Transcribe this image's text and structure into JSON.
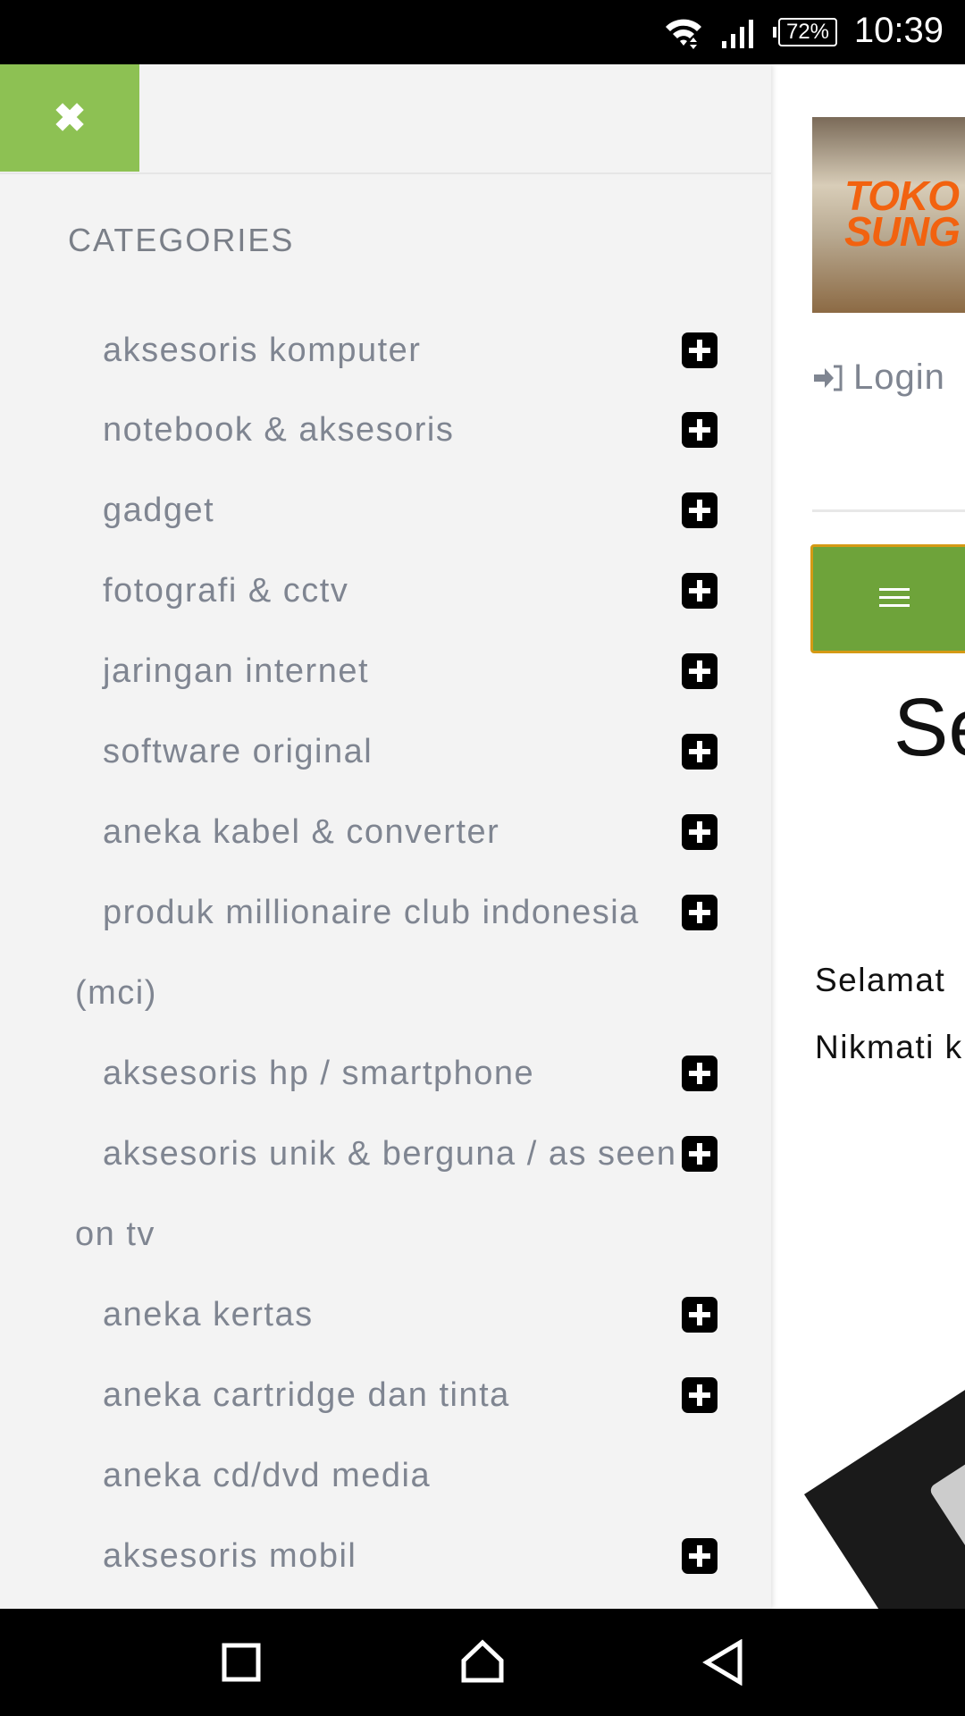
{
  "status_bar": {
    "time": "10:39",
    "battery": "72%",
    "icons": [
      "wifi-icon",
      "signal-icon",
      "battery-icon"
    ]
  },
  "page": {
    "logo_text": "TOKO SUNG",
    "login_label": "Login",
    "heading": "Se",
    "paragraphs": [
      "Selamat",
      "Nikmati k"
    ]
  },
  "drawer": {
    "close_icon": "close-icon",
    "title": "CATEGORIES",
    "items": [
      {
        "label": "aksesoris komputer",
        "expandable": true
      },
      {
        "label": "notebook & aksesoris",
        "expandable": true
      },
      {
        "label": "gadget",
        "expandable": true
      },
      {
        "label": "fotografi & cctv",
        "expandable": true
      },
      {
        "label": "jaringan internet",
        "expandable": true
      },
      {
        "label": "software original",
        "expandable": true
      },
      {
        "label": "aneka kabel & converter",
        "expandable": true
      },
      {
        "label": "produk millionaire club indonesia (mci)",
        "expandable": true
      },
      {
        "label": "aksesoris hp / smartphone",
        "expandable": true
      },
      {
        "label": "aksesoris unik & berguna / as seen on tv",
        "expandable": true
      },
      {
        "label": "aneka kertas",
        "expandable": true
      },
      {
        "label": "aneka cartridge dan tinta",
        "expandable": true
      },
      {
        "label": "aneka cd/dvd media",
        "expandable": false
      },
      {
        "label": "aksesoris mobil",
        "expandable": true
      }
    ]
  },
  "colors": {
    "close_button": "#8dc153",
    "menu_button": "#6ea33a",
    "menu_border": "#d59a14",
    "drawer_bg": "#f3f3f3",
    "item_text": "#7f8591"
  }
}
